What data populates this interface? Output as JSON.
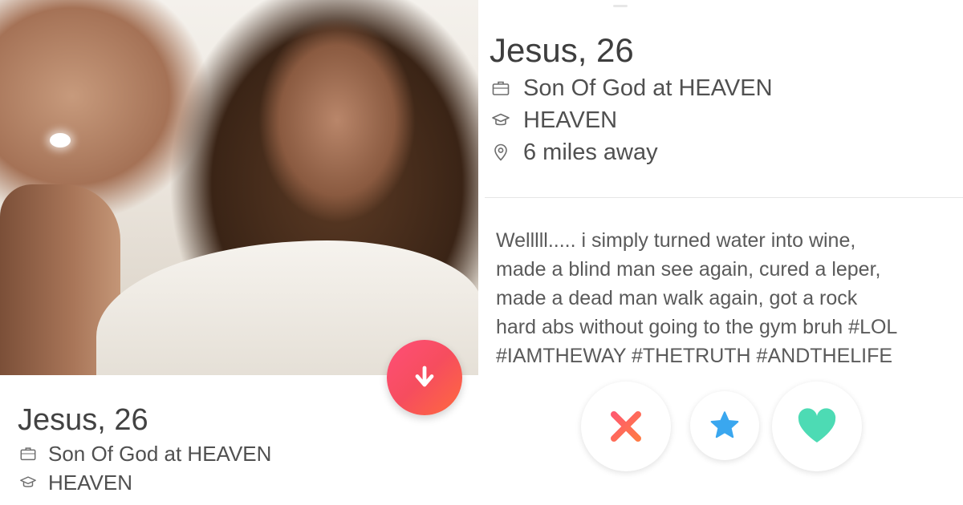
{
  "left_card": {
    "name_age": "Jesus, 26",
    "job": "Son Of God at HEAVEN",
    "school": "HEAVEN",
    "icons": {
      "job": "briefcase-icon",
      "school": "graduation-cap-icon",
      "expand": "arrow-down-icon"
    }
  },
  "right_profile": {
    "name_age": "Jesus, 26",
    "job": "Son Of God at HEAVEN",
    "school": "HEAVEN",
    "distance": "6 miles away",
    "bio": "Welllll..... i simply turned water into wine,\nmade a blind man see again, cured a leper,\nmade a dead man walk again, got a rock\nhard abs without going to the gym bruh #LOL\n#IAMTHEWAY #THETRUTH #ANDTHELIFE",
    "icons": {
      "job": "briefcase-icon",
      "school": "graduation-cap-icon",
      "distance": "location-pin-icon"
    }
  },
  "actions": {
    "icons": [
      "close-icon",
      "star-icon",
      "heart-icon"
    ]
  },
  "colors": {
    "brand_gradient_start": "#ff4f77",
    "brand_gradient_end": "#ff6a3e",
    "nope": "#f65a62",
    "super_like": "#3aa7ef",
    "like": "#4ddbb4",
    "text_primary": "#424242",
    "text_secondary": "#5a5a5a"
  }
}
